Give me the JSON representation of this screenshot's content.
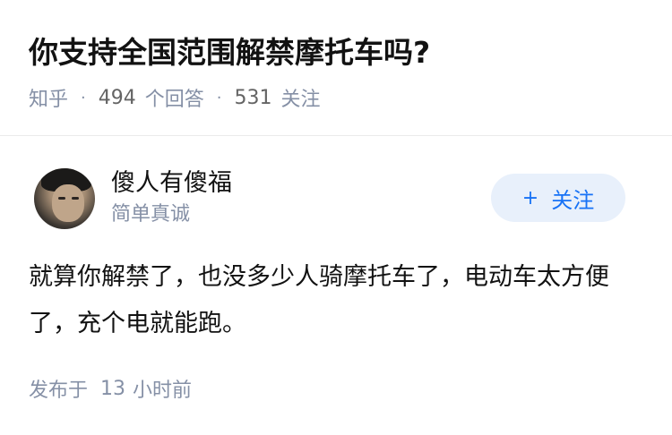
{
  "question": {
    "title": "你支持全国范围解禁摩托车吗?",
    "source": "知乎",
    "answer_count": "494",
    "answer_unit": "个回答",
    "follower_count": "531",
    "follower_unit": "关注",
    "separator": "·"
  },
  "author": {
    "name": "傻人有傻福",
    "bio": "简单真诚",
    "avatar": "avatar-photo"
  },
  "follow_button": {
    "plus": "+",
    "label": "关注",
    "color": "#1772f6",
    "background": "#e8f0fb"
  },
  "answer": {
    "text": "就算你解禁了，也没多少人骑摩托车了，电动车太方便了，充个电就能跑。",
    "published_label": "发布于",
    "published_num": "13",
    "published_unit": "小时前"
  }
}
